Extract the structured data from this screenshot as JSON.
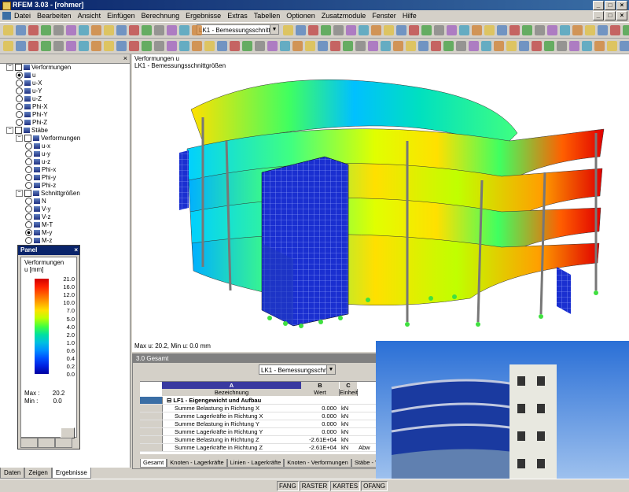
{
  "window": {
    "title": "RFEM 3.03 - [rohmer]"
  },
  "menu": [
    "Datei",
    "Bearbeiten",
    "Ansicht",
    "Einfügen",
    "Berechnung",
    "Ergebnisse",
    "Extras",
    "Tabellen",
    "Optionen",
    "Zusatzmodule",
    "Fenster",
    "Hilfe"
  ],
  "toolbar": {
    "loadcase": "LK1 - Bemessungsschnittgröße"
  },
  "navigator": {
    "tree": [
      {
        "label": "Verformungen",
        "type": "check",
        "expanded": true,
        "level": 0
      },
      {
        "label": "u",
        "type": "radio",
        "selected": true,
        "level": 1
      },
      {
        "label": "u-X",
        "type": "radio",
        "level": 1
      },
      {
        "label": "u-Y",
        "type": "radio",
        "level": 1
      },
      {
        "label": "u-Z",
        "type": "radio",
        "level": 1
      },
      {
        "label": "Phi-X",
        "type": "radio",
        "level": 1
      },
      {
        "label": "Phi-Y",
        "type": "radio",
        "level": 1
      },
      {
        "label": "Phi-Z",
        "type": "radio",
        "level": 1
      },
      {
        "label": "Stäbe",
        "type": "check",
        "expanded": true,
        "level": 0
      },
      {
        "label": "Verformungen",
        "type": "check",
        "expanded": true,
        "level": 1
      },
      {
        "label": "u-x",
        "type": "radio",
        "level": 2
      },
      {
        "label": "u-y",
        "type": "radio",
        "level": 2
      },
      {
        "label": "u-z",
        "type": "radio",
        "level": 2
      },
      {
        "label": "Phi-x",
        "type": "radio",
        "level": 2
      },
      {
        "label": "Phi-y",
        "type": "radio",
        "level": 2
      },
      {
        "label": "Phi-z",
        "type": "radio",
        "level": 2
      },
      {
        "label": "Schnittgrößen",
        "type": "check",
        "expanded": true,
        "level": 1
      },
      {
        "label": "N",
        "type": "radio",
        "level": 2
      },
      {
        "label": "V-y",
        "type": "radio",
        "level": 2
      },
      {
        "label": "V-z",
        "type": "radio",
        "level": 2
      },
      {
        "label": "M-T",
        "type": "radio",
        "level": 2
      },
      {
        "label": "M-y",
        "type": "radio",
        "selected": true,
        "level": 2
      },
      {
        "label": "M-z",
        "type": "radio",
        "level": 2
      }
    ],
    "tabs": [
      "Daten",
      "Zeigen",
      "Ergebnisse"
    ]
  },
  "panel": {
    "title": "Panel",
    "legend_title": "Verformungen",
    "legend_unit": "u [mm]",
    "scale_values": [
      "21.0",
      "16.0",
      "12.0",
      "10.0",
      "7.0",
      "5.0",
      "4.0",
      "2.0",
      "1.0",
      "0.6",
      "0.4",
      "0.2",
      "0.0"
    ],
    "scale_colors": [
      "#d00000",
      "#ff2000",
      "#ff6000",
      "#ffa000",
      "#ffe000",
      "#c0ff00",
      "#40ff40",
      "#00e0a0",
      "#00c0e0",
      "#0090ff",
      "#0050ff",
      "#0020e0",
      "#0000a0"
    ],
    "max_label": "Max :",
    "max_value": "20.2",
    "min_label": "Min :",
    "min_value": "0.0"
  },
  "graphics": {
    "title1": "Verformungen u",
    "title2": "LK1 - Bemessungsschnittgrößen",
    "status": "Max u: 20.2, Min u: 0.0 mm"
  },
  "table": {
    "title": "3.0 Gesamt",
    "loadcase": "LK1 - Bemessungsschnit",
    "col_letters": [
      "A",
      "B",
      "C"
    ],
    "col_headers": [
      "Bezeichnung",
      "Wert",
      "Einheit"
    ],
    "group": "LF1 - Eigengewicht und Aufbau",
    "rows": [
      {
        "name": "Summe Belastung in Richtung X",
        "value": "0.000",
        "unit": "kN",
        "extra": ""
      },
      {
        "name": "Summe Lagerkräfte in Richtung X",
        "value": "0.000",
        "unit": "kN",
        "extra": ""
      },
      {
        "name": "Summe Belastung in Richtung Y",
        "value": "0.000",
        "unit": "kN",
        "extra": ""
      },
      {
        "name": "Summe Lagerkräfte in Richtung Y",
        "value": "0.000",
        "unit": "kN",
        "extra": ""
      },
      {
        "name": "Summe Belastung in Richtung Z",
        "value": "-2.61E+04",
        "unit": "kN",
        "extra": ""
      },
      {
        "name": "Summe Lagerkräfte in Richtung Z",
        "value": "-2.61E+04",
        "unit": "kN",
        "extra": "Abw"
      }
    ],
    "tabs": [
      "Gesamt",
      "Knoten - Lagerkräfte",
      "Linien - Lagerkräfte",
      "Knoten - Verformungen",
      "Stäbe - Verformungen"
    ]
  },
  "statusbar": [
    "FANG",
    "RASTER",
    "KARTES",
    "OFANG"
  ]
}
